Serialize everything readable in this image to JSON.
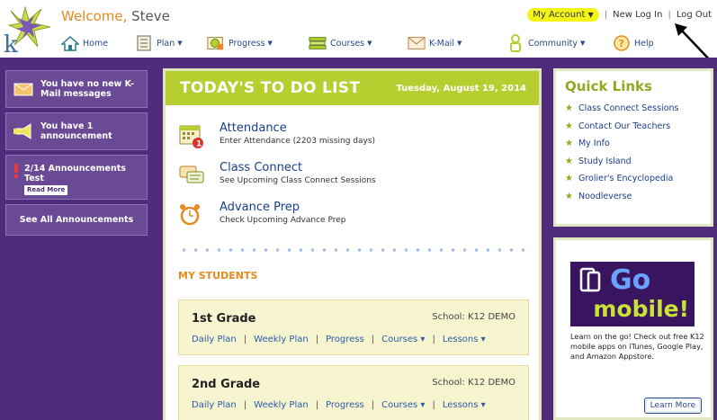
{
  "header": {
    "welcome_prefix": "Welcome, ",
    "user_name": "Steve",
    "my_account": "My Account",
    "new_login": "New Log In",
    "logout": "Log Out",
    "separator": "|"
  },
  "nav": {
    "items": [
      {
        "label": "Home",
        "icon": "home-icon"
      },
      {
        "label": "Plan",
        "icon": "plan-icon"
      },
      {
        "label": "Progress",
        "icon": "progress-icon"
      },
      {
        "label": "Courses",
        "icon": "courses-icon"
      },
      {
        "label": "K-Mail",
        "icon": "mail-icon"
      },
      {
        "label": "Community",
        "icon": "community-icon"
      },
      {
        "label": "Help",
        "icon": "help-icon"
      }
    ],
    "caret": "▼"
  },
  "sidebar": {
    "kmail": "You have no new K-Mail messages",
    "announcement": "You have 1 announcement",
    "announcement_item": "2/14 Announcements Test",
    "read_more": "Read More",
    "see_all": "See All Announcements"
  },
  "todo": {
    "title": "TODAY'S TO DO LIST",
    "date": "Tuesday, August 19, 2014",
    "tasks": [
      {
        "name": "Attendance",
        "desc": "Enter Attendance (2203 missing days)",
        "badge": "1"
      },
      {
        "name": "Class Connect",
        "desc": "See Upcoming Class Connect Sessions"
      },
      {
        "name": "Advance Prep",
        "desc": "Check Upcoming Advance Prep"
      }
    ]
  },
  "students": {
    "heading": "MY STUDENTS",
    "grades": [
      {
        "name": "1st Grade",
        "school": "School: K12 DEMO",
        "links": [
          "Daily Plan",
          "Weekly Plan",
          "Progress",
          "Courses ▾",
          "Lessons ▾"
        ]
      },
      {
        "name": "2nd Grade",
        "school": "School: K12 DEMO",
        "links": [
          "Daily Plan",
          "Weekly Plan",
          "Progress",
          "Courses ▾",
          "Lessons ▾"
        ]
      }
    ]
  },
  "quick_links": {
    "title": "Quick Links",
    "items": [
      "Class Connect Sessions",
      "Contact Our Teachers",
      "My Info",
      "Study Island",
      "Grolier's Encyclopedia",
      "Noodleverse"
    ]
  },
  "mobile": {
    "go": "Go",
    "mobile": "mobile!",
    "text": "Learn on the go! Check out free K12 mobile apps on iTunes, Google Play, and Amazon Appstore.",
    "button": "Learn More"
  },
  "colors": {
    "purple": "#4f2d7c",
    "lime": "#b6ce2f",
    "orange": "#e68a1f",
    "highlight": "#f3f516"
  }
}
